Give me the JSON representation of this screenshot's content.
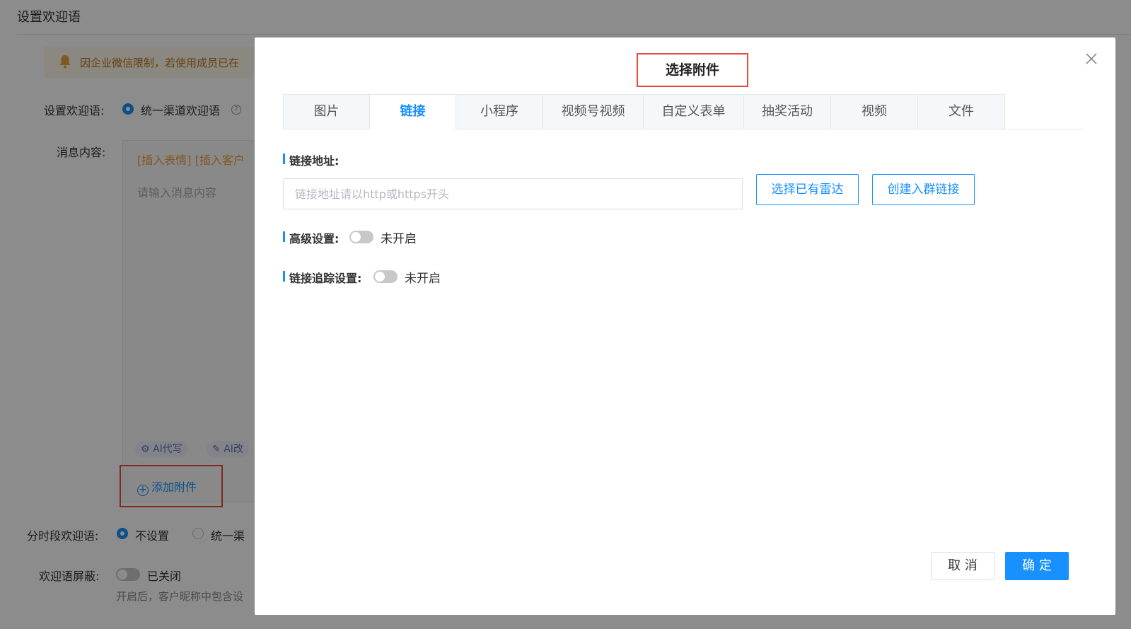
{
  "page": {
    "title": "设置欢迎语",
    "notice": "因企业微信限制，若使用成员已在",
    "welcome_label": "设置欢迎语:",
    "welcome_option": "统一渠道欢迎语",
    "message_label": "消息内容:",
    "toolbar_text": "[插入表情] [插入客户",
    "message_placeholder": "请输入消息内容",
    "ai_write": "AI代写",
    "ai_rewrite": "AI改",
    "add_attachment": "添加附件",
    "timed_label": "分时段欢迎语:",
    "timed_option_none": "不设置",
    "timed_option_unified": "统一渠",
    "shield_label": "欢迎语屏蔽:",
    "shield_status": "已关闭",
    "shield_hint": "开启后，客户昵称中包含设"
  },
  "dialog": {
    "title": "选择附件",
    "tabs": [
      {
        "label": "图片",
        "active": false
      },
      {
        "label": "链接",
        "active": true
      },
      {
        "label": "小程序",
        "active": false
      },
      {
        "label": "视频号视频",
        "active": false
      },
      {
        "label": "自定义表单",
        "active": false
      },
      {
        "label": "抽奖活动",
        "active": false
      },
      {
        "label": "视频",
        "active": false
      },
      {
        "label": "文件",
        "active": false
      }
    ],
    "url_label": "链接地址:",
    "url_placeholder": "链接地址请以http或https开头",
    "url_value": "",
    "select_radar_button": "选择已有雷达",
    "create_group_link_button": "创建入群链接",
    "advanced_label": "高级设置:",
    "advanced_status": "未开启",
    "tracking_label": "链接追踪设置:",
    "tracking_status": "未开启",
    "cancel_button": "取 消",
    "confirm_button": "确 定"
  },
  "colors": {
    "accent": "#1890ff",
    "highlight_box": "#e34a3c",
    "notice_bg": "#fdf6ec",
    "notice_text": "#b8741a"
  }
}
